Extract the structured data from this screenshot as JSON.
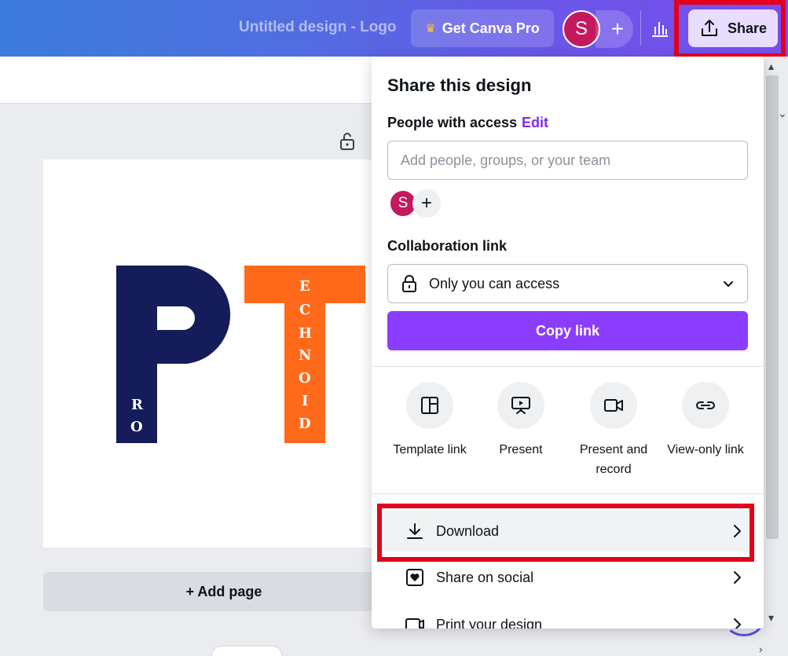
{
  "topbar": {
    "doc_title": "Untitled design - Logo",
    "pro_label": "Get Canva Pro",
    "avatar_initial": "S",
    "share_label": "Share"
  },
  "canvas": {
    "add_page_label": "+ Add page",
    "logo": {
      "p_letters": [
        "R",
        "O"
      ],
      "t_letters": [
        "E",
        "C",
        "H",
        "N",
        "O",
        "I",
        "D"
      ],
      "p_color": "#141c5a",
      "t_color": "#ff6a1a"
    }
  },
  "share_panel": {
    "title": "Share this design",
    "people_access_label": "People with access",
    "edit_label": "Edit",
    "people_input_placeholder": "Add people, groups, or your team",
    "member_initial": "S",
    "collab_link_label": "Collaboration link",
    "access_value": "Only you can access",
    "copy_link_label": "Copy link",
    "options": [
      {
        "label": "Template link",
        "icon": "template-icon"
      },
      {
        "label": "Present",
        "icon": "present-icon"
      },
      {
        "label": "Present and record",
        "icon": "video-record-icon"
      },
      {
        "label": "View-only link",
        "icon": "link-icon"
      }
    ],
    "menu": [
      {
        "label": "Download",
        "icon": "download-icon"
      },
      {
        "label": "Share on social",
        "icon": "heart-icon"
      },
      {
        "label": "Print your design",
        "icon": "print-icon"
      }
    ]
  },
  "colors": {
    "accent": "#8b3dff",
    "highlight": "#e3001b",
    "avatar": "#c4185f"
  }
}
